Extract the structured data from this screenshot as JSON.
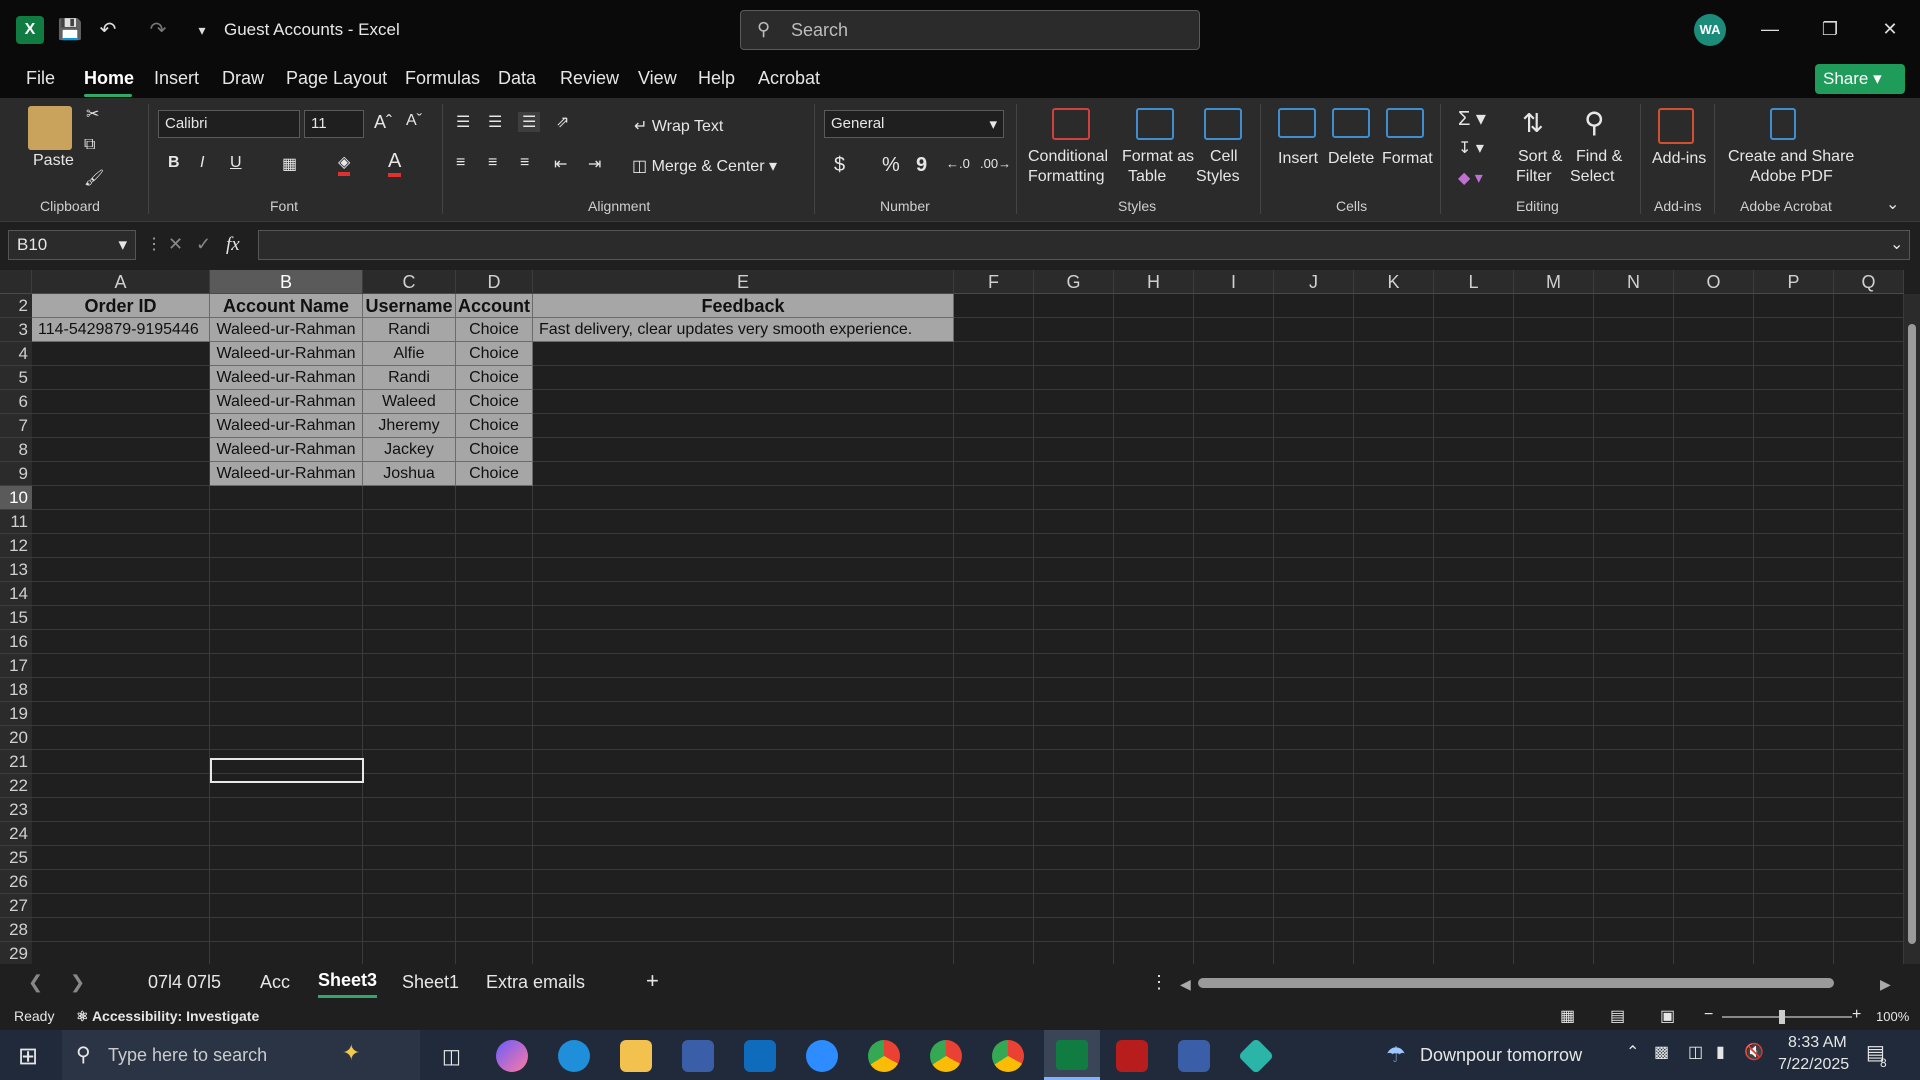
{
  "titlebar": {
    "title": "Guest Accounts  -  Excel",
    "search_placeholder": "Search",
    "avatar_initials": "WA"
  },
  "menu": {
    "items": [
      "File",
      "Home",
      "Insert",
      "Draw",
      "Page Layout",
      "Formulas",
      "Data",
      "Review",
      "View",
      "Help",
      "Acrobat"
    ],
    "active": "Home",
    "share_label": "Share"
  },
  "ribbon": {
    "clipboard": {
      "paste": "Paste",
      "group": "Clipboard"
    },
    "font": {
      "name": "Calibri",
      "size": "11",
      "bold": "B",
      "italic": "I",
      "underline": "U",
      "group": "Font"
    },
    "alignment": {
      "wrap": "Wrap Text",
      "merge": "Merge & Center",
      "group": "Alignment"
    },
    "number": {
      "format": "General",
      "dollar": "$",
      "percent": "%",
      "comma": "9",
      "group": "Number"
    },
    "styles": {
      "conditional_1": "Conditional",
      "conditional_2": "Formatting",
      "format_table_1": "Format as",
      "format_table_2": "Table",
      "cell_styles_1": "Cell",
      "cell_styles_2": "Styles",
      "group": "Styles"
    },
    "cells": {
      "insert": "Insert",
      "delete": "Delete",
      "format": "Format",
      "group": "Cells"
    },
    "editing": {
      "sort_1": "Sort &",
      "sort_2": "Filter",
      "find_1": "Find &",
      "find_2": "Select",
      "group": "Editing"
    },
    "addins": {
      "label": "Add-ins",
      "group": "Add-ins"
    },
    "acrobat": {
      "label_1": "Create and Share",
      "label_2": "Adobe PDF",
      "group": "Adobe Acrobat"
    }
  },
  "formula_bar": {
    "name_box": "B10",
    "fx": "fx",
    "content": ""
  },
  "grid": {
    "columns": [
      "A",
      "B",
      "C",
      "D",
      "E",
      "F",
      "G",
      "H",
      "I",
      "J",
      "K",
      "L",
      "M",
      "N",
      "O",
      "P",
      "Q"
    ],
    "rows": [
      "2",
      "3",
      "4",
      "5",
      "6",
      "7",
      "8",
      "9",
      "10",
      "11",
      "12",
      "13",
      "14",
      "15",
      "16",
      "17",
      "18",
      "19",
      "20",
      "21",
      "22",
      "23",
      "24",
      "25",
      "26",
      "27",
      "28",
      "29"
    ],
    "headers": [
      "Order ID",
      "Account Name",
      "Username",
      "Account",
      "Feedback"
    ],
    "data": [
      [
        "114-5429879-9195446",
        "Waleed-ur-Rahman",
        "Randi",
        "Choice",
        "Fast delivery, clear updates very smooth experience."
      ],
      [
        "",
        "Waleed-ur-Rahman",
        "Alfie",
        "Choice",
        ""
      ],
      [
        "",
        "Waleed-ur-Rahman",
        "Randi",
        "Choice",
        ""
      ],
      [
        "",
        "Waleed-ur-Rahman",
        "Waleed",
        "Choice",
        ""
      ],
      [
        "",
        "Waleed-ur-Rahman",
        "Jheremy",
        "Choice",
        ""
      ],
      [
        "",
        "Waleed-ur-Rahman",
        "Jackey",
        "Choice",
        ""
      ],
      [
        "",
        "Waleed-ur-Rahman",
        "Joshua",
        "Choice",
        ""
      ]
    ]
  },
  "sheet_tabs": {
    "tabs": [
      "07l4 07l5",
      "Acc",
      "Sheet3",
      "Sheet1",
      "Extra emails"
    ],
    "active": "Sheet3",
    "add": "+"
  },
  "status": {
    "ready": "Ready",
    "accessibility": "Accessibility: Investigate",
    "zoom": "100%"
  },
  "taskbar": {
    "search_placeholder": "Type here to search",
    "weather": "Downpour tomorrow",
    "time": "8:33 AM",
    "date": "7/22/2025",
    "notif_count": "8"
  },
  "colors": {
    "accent_green": "#1f9b5a",
    "cell_fill": "#a6a6a6",
    "excel_green": "#107c41"
  }
}
